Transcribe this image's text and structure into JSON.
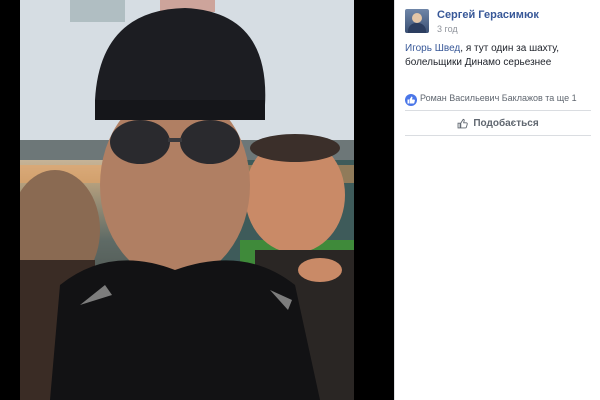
{
  "photo": {
    "icon": "selfie-photo"
  },
  "post": {
    "author": "Сергей Герасимюк",
    "time": "3 год",
    "mention": "Игорь Швед",
    "text": ", я тут один за шахту, болельщики Динамо серьезнее",
    "likes": "Роман Васильевич Баклажов та ще 1",
    "like_button": "Подобається"
  },
  "colors": {
    "link": "#385898",
    "like_badge": "#4a76e8",
    "secondary_text": "#90949c"
  }
}
